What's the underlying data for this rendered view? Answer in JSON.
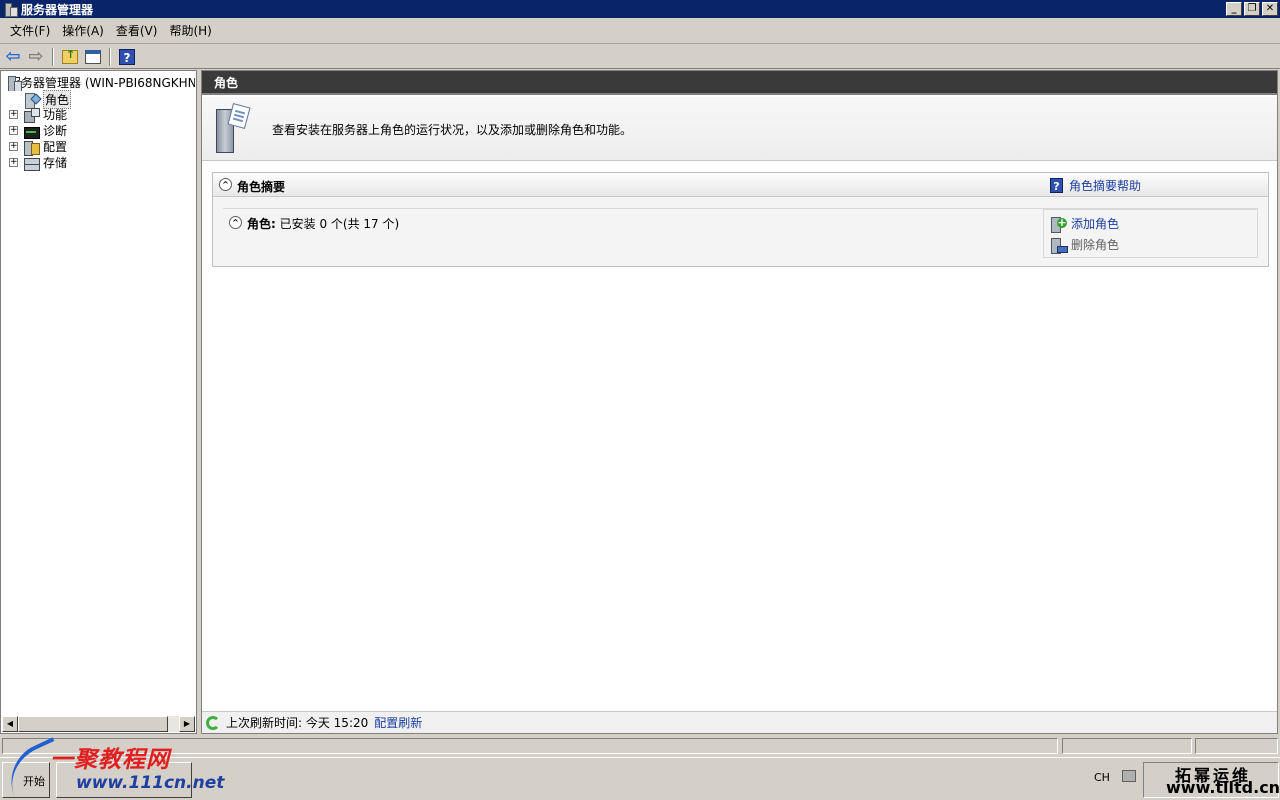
{
  "window": {
    "title": "服务器管理器",
    "buttons": {
      "minimize": "_",
      "restore": "❐",
      "close": "✕"
    }
  },
  "menubar": {
    "items": [
      {
        "label": "文件(F)"
      },
      {
        "label": "操作(A)"
      },
      {
        "label": "查看(V)"
      },
      {
        "label": "帮助(H)"
      }
    ]
  },
  "toolbar": {
    "back_icon": "back-arrow-icon",
    "forward_icon": "forward-arrow-icon",
    "help_glyph": "?"
  },
  "tree": {
    "root_label": "服务器管理器 (WIN-PBI68NGKHN",
    "items": [
      {
        "label": "角色",
        "expandable": false,
        "selected": true
      },
      {
        "label": "功能",
        "expandable": true
      },
      {
        "label": "诊断",
        "expandable": true
      },
      {
        "label": "配置",
        "expandable": true
      },
      {
        "label": "存储",
        "expandable": true
      }
    ],
    "expander_glyph": "+",
    "scroll_left": "◀",
    "scroll_right": "▶"
  },
  "content": {
    "header": "角色",
    "intro_text": "查看安装在服务器上角色的运行状况，以及添加或删除角色和功能。",
    "summary": {
      "title": "角色摘要",
      "help_link": "角色摘要帮助",
      "help_glyph": "?",
      "collapse_glyph": "^",
      "roles_label": "角色:",
      "roles_status": "已安装 0 个(共 17 个)",
      "actions": {
        "add": "添加角色",
        "remove": "删除角色"
      }
    },
    "refresh": {
      "label": "上次刷新时间: 今天 15:20",
      "link": "配置刷新"
    }
  },
  "taskbar": {
    "start_label": "开始",
    "language": "CH"
  },
  "watermarks": {
    "left_cn": "一聚教程网",
    "left_url": "www.111cn.net",
    "right_cn": "拓幂运维",
    "right_url": "www.tlltd.cn"
  },
  "colors": {
    "title_bar": "#0a246a",
    "content_header": "#3a3a3a",
    "link": "#1a3ea0",
    "watermark_red": "#e02020"
  }
}
